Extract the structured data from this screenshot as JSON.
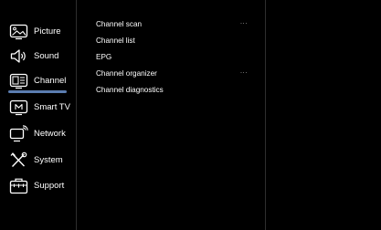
{
  "sidebar": {
    "items": [
      {
        "label": "Picture",
        "icon": "picture-icon"
      },
      {
        "label": "Sound",
        "icon": "speaker-icon"
      },
      {
        "label": "Channel",
        "icon": "channel-icon",
        "active": true
      },
      {
        "label": "Smart TV",
        "icon": "smart-tv-icon"
      },
      {
        "label": "Network",
        "icon": "network-icon"
      },
      {
        "label": "System",
        "icon": "system-tools-icon"
      },
      {
        "label": "Support",
        "icon": "support-icon"
      }
    ]
  },
  "submenu": {
    "items": [
      {
        "label": "Channel scan",
        "more": "..."
      },
      {
        "label": "Channel list",
        "more": ""
      },
      {
        "label": "EPG",
        "more": ""
      },
      {
        "label": "Channel organizer",
        "more": "..."
      },
      {
        "label": "Channel diagnostics",
        "more": ""
      }
    ]
  },
  "colors": {
    "background": "#000000",
    "text": "#ffffff",
    "active_indicator": "#5b7db0",
    "divider": "#2e2e2e"
  }
}
